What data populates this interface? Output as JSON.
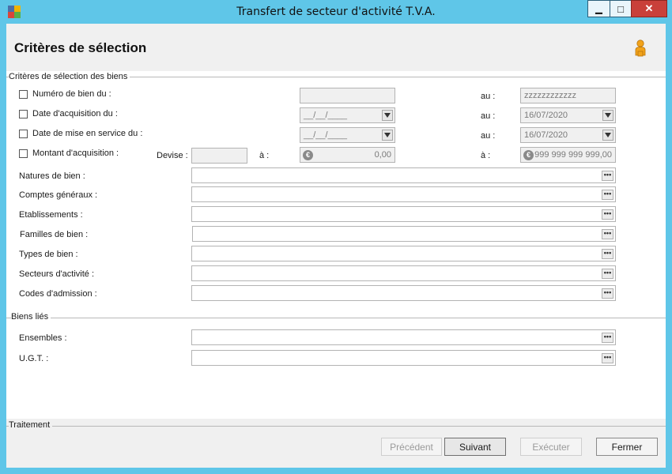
{
  "window": {
    "title": "Transfert de secteur d'activité T.V.A.",
    "minimize_glyph": "▁",
    "maximize_glyph": "□",
    "close_glyph": "✕"
  },
  "header": {
    "title": "Critères de sélection",
    "icon": "user-icon"
  },
  "selection_group": {
    "label": "Critères de sélection des biens",
    "rows": {
      "numero": {
        "label": "Numéro de bien du :",
        "from_value": "",
        "to_label": "au :",
        "to_value": "zzzzzzzzzzzz"
      },
      "acquisition_date": {
        "label": "Date d'acquisition du :",
        "from_value": "__/__/____",
        "to_label": "au :",
        "to_value": "16/07/2020"
      },
      "service_date": {
        "label": "Date de mise en service du :",
        "from_value": "__/__/____",
        "to_label": "au :",
        "to_value": "16/07/2020"
      },
      "montant": {
        "label": "Montant d'acquisition :",
        "devise_label": "Devise :",
        "devise_value": "",
        "from_label": "à :",
        "from_value": "0,00",
        "to_label": "à :",
        "to_value": "999 999 999 999,00",
        "currency_symbol": "€"
      }
    },
    "pickers": [
      {
        "label": "Natures de bien :",
        "value": ""
      },
      {
        "label": "Comptes généraux :",
        "value": ""
      },
      {
        "label": "Etablissements :",
        "value": ""
      },
      {
        "label": "Familles de bien :",
        "value": ""
      },
      {
        "label": "Types de bien :",
        "value": ""
      },
      {
        "label": "Secteurs d'activité :",
        "value": ""
      },
      {
        "label": "Codes d'admission :",
        "value": ""
      }
    ]
  },
  "linked_group": {
    "label": "Biens liés",
    "pickers": [
      {
        "label": "Ensembles :",
        "value": ""
      },
      {
        "label": "U.G.T. :",
        "value": ""
      }
    ]
  },
  "ellipsis": "•••",
  "footer": {
    "label": "Traitement",
    "buttons": {
      "previous": "Précédent",
      "next": "Suivant",
      "execute": "Exécuter",
      "close": "Fermer"
    }
  },
  "colors": {
    "titlebar": "#5fc6e8",
    "close_button": "#c9403a",
    "user_icon": "#f2a31b"
  }
}
